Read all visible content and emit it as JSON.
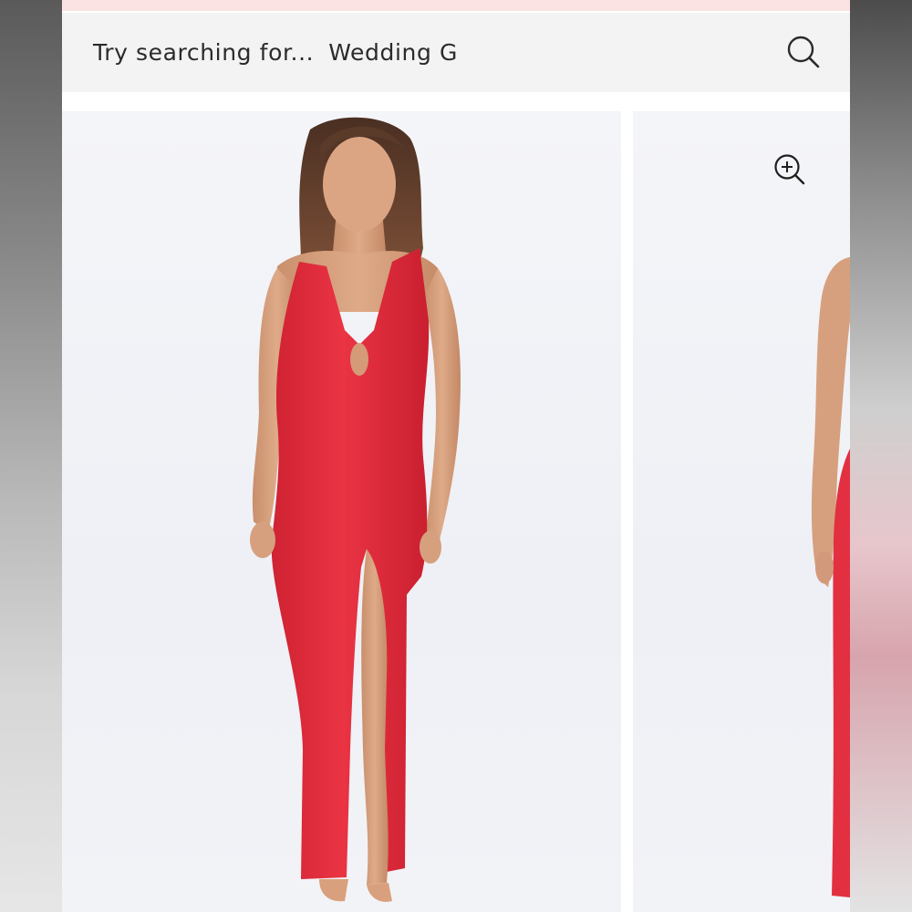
{
  "search": {
    "placeholder": "Try searching for...",
    "rotating_suggestion": "Wedding G",
    "icon": "search-icon"
  },
  "gallery": {
    "zoom_icon": "zoom-in-icon",
    "images": [
      {
        "name": "product-image-front"
      },
      {
        "name": "product-image-side"
      }
    ]
  },
  "colors": {
    "dress": "#e8303f",
    "promo_strip": "#fbe3e3",
    "search_bg": "#f3f3f3"
  }
}
